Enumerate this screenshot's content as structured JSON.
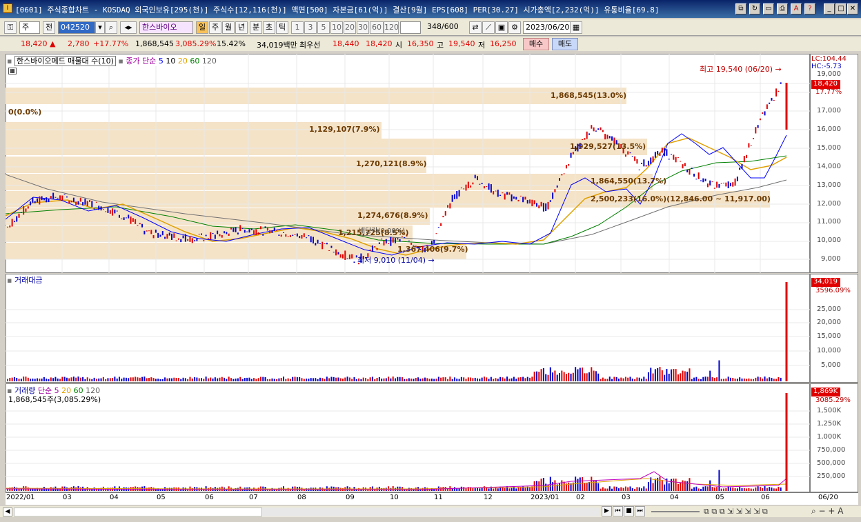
{
  "window": {
    "title": "[0601] 주식종합차트 - KOSDAQ 외국인보유[295(천)] 주식수[12,116(천)] 액면[500] 자본금[61(억)] 결산[9월] EPS[608] PER[30.27] 시가총액[2,232(억)] 유통비율[69.8]",
    "icon": "I"
  },
  "toolbar": {
    "type_select": "주",
    "prev_label": "전",
    "code": "042520",
    "stock_name": "한스바이오",
    "period_buttons": [
      "일",
      "주",
      "월",
      "년",
      "분",
      "초",
      "틱"
    ],
    "interval_buttons": [
      "1",
      "3",
      "5",
      "10",
      "20",
      "30",
      "60",
      "120"
    ],
    "count": "348",
    "count_total": "/600",
    "date": "2023/06/20"
  },
  "quote": {
    "price": "18,420",
    "change": "2,780",
    "change_pct": "+17.77%",
    "volume": "1,868,545",
    "volume_pct": "3,085.29%",
    "turnover": "15.42%",
    "amount": "34,019백만",
    "best_ask_label": "최우선",
    "best_ask": "18,440",
    "best_bid": "18,420",
    "open_label": "시",
    "open": "16,350",
    "high_label": "고",
    "high": "19,540",
    "low_label": "저",
    "low": "16,250",
    "buy_label": "매수",
    "sell_label": "매도"
  },
  "price_panel": {
    "legend_name": "한스바이오메드 매물대 수(10)",
    "ma_label": "종가 단순",
    "ma_periods": [
      "5",
      "10",
      "20",
      "60",
      "120"
    ],
    "lc": "LC:104.44",
    "hc": "HC:-5.73",
    "current_price": "18,420",
    "current_pct": "17.77%",
    "high_note": "최고 19,540 (06/20)",
    "low_note": "최저 9,010 (11/04)",
    "y_ticks": [
      "19,000",
      "17,000",
      "16,000",
      "15,000",
      "14,000",
      "13,000",
      "12,000",
      "11,000",
      "10,000",
      "9,000"
    ],
    "bands": [
      {
        "label": "1,868,545(13.0%)"
      },
      {
        "label": "0(0.0%)"
      },
      {
        "label": "1,129,107(7.9%)"
      },
      {
        "label": "1,929,527(13.5%)"
      },
      {
        "label": "1,270,121(8.9%)"
      },
      {
        "label": "1,864,550(13.7%)"
      },
      {
        "label": "2,500,233(16.0%)(12,846.00 ~ 11,917.00)"
      },
      {
        "label": "1,274,676(8.9%)"
      },
      {
        "label": "1,215,725(8.5%)"
      },
      {
        "label": "배당락(0.00%)"
      },
      {
        "label": "1,367,406(9.7%)"
      }
    ]
  },
  "amount_panel": {
    "title": "거래대금",
    "current": "34,019",
    "current_pct": "3596.09%",
    "y_ticks": [
      "25,000",
      "20,000",
      "15,000",
      "10,000",
      "5,000"
    ]
  },
  "volume_panel": {
    "title": "거래량",
    "ma_label": "단순",
    "ma_periods": [
      "5",
      "20",
      "60",
      "120"
    ],
    "sub": "1,868,545주(3,085.29%)",
    "current": "1,869K",
    "current_pct": "3085.29%",
    "y_ticks": [
      "1,500K",
      "1,250K",
      "1,000K",
      "750,000",
      "500,000",
      "250,000"
    ]
  },
  "x_axis": {
    "labels": [
      "2022/01",
      "03",
      "04",
      "05",
      "06",
      "07",
      "08",
      "09",
      "10",
      "11",
      "12",
      "2023/01",
      "02",
      "03",
      "04",
      "05",
      "06"
    ],
    "right_label": "06/20"
  },
  "chart_data": {
    "type": "candlestick",
    "series": [
      {
        "name": "price",
        "values": [
          10900,
          12200,
          12500,
          12300,
          12000,
          11500,
          10600,
          10400,
          10300,
          10500,
          10800,
          10700,
          10600,
          10300,
          9600,
          9200,
          10100,
          10300,
          9700,
          12400,
          13500,
          12600,
          12400,
          11900,
          14500,
          16200,
          15300,
          14100,
          14900,
          14000,
          13100,
          13100,
          16200,
          18420
        ]
      }
    ],
    "ylim": [
      8500,
      20000
    ]
  },
  "colors": {
    "up": "#e00000",
    "down": "#0000d0",
    "band": "#f5e3c8",
    "ma5": "#0000ff",
    "ma20": "#e0a000",
    "ma60": "#008000",
    "ma120": "#606060"
  }
}
